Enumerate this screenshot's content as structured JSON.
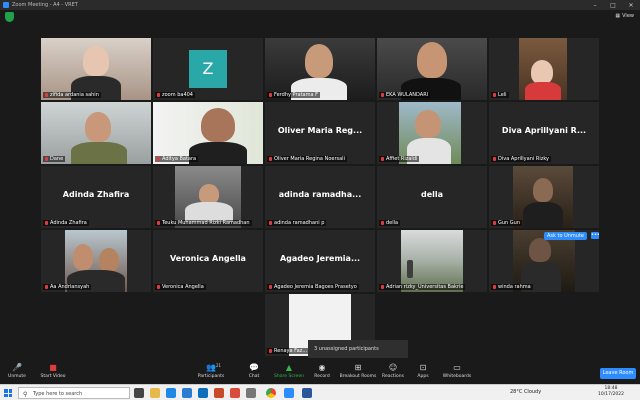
{
  "window": {
    "title": "Zoom Meeting - A4 - VRET",
    "controls": [
      "–",
      "□",
      "✕"
    ]
  },
  "topbar": {
    "view_label": "View"
  },
  "participants": [
    {
      "name": "zifida ardania sahin"
    },
    {
      "name": "zoom ba404",
      "avatar_letter": "Z"
    },
    {
      "name": "Ferdhy Pratama F"
    },
    {
      "name": "EKA WULANDARI"
    },
    {
      "name": "Leli"
    },
    {
      "name": "Dane"
    },
    {
      "name": "Aditya Batara"
    },
    {
      "name": "Oliver Maria Regina Noersali",
      "display": "Oliver Maria Reg..."
    },
    {
      "name": "Affiet Rizaldi"
    },
    {
      "name": "Diva Aprillyani Rizky",
      "display": "Diva Aprillyani R..."
    },
    {
      "name": "Adinda Zhafira",
      "display": "Adinda Zhafira"
    },
    {
      "name": "Teuku Muhammad Rizki Ramadhan"
    },
    {
      "name": "adinda ramadhani p",
      "display": "adinda ramadha..."
    },
    {
      "name": "della",
      "display": "della"
    },
    {
      "name": "Gun Gun"
    },
    {
      "name": "Aa Andriansyah"
    },
    {
      "name": "Veronica Angella",
      "display": "Veronica Angella"
    },
    {
      "name": "Agadeo Jeremia Bagoes Prasetyo",
      "display": "Agadeo Jeremia..."
    },
    {
      "name": "Adrian rizky_Universitas Bakrie"
    },
    {
      "name": "winda rahma"
    },
    {
      "name": "Renaya Faz..."
    }
  ],
  "ask_to_unmute": "Ask to Unmute",
  "more_dots": "•••",
  "unassigned": "3 unassigned participants",
  "toolbar": {
    "unmute": "Unmute",
    "start_video": "Start Video",
    "participants": "Participants",
    "participants_count": "21",
    "chat": "Chat",
    "share_screen": "Share Screen",
    "record": "Record",
    "breakout_rooms": "Breakout Rooms",
    "reactions": "Reactions",
    "apps": "Apps",
    "whiteboards": "Whiteboards",
    "leave": "Leave Room"
  },
  "taskbar": {
    "search_placeholder": "Type here to search",
    "weather": "28°C  Cloudy",
    "time": "18:48",
    "date": "10/17/2022"
  },
  "colors": {
    "accent": "#2d8cff",
    "active_speaker": "#8fd14f",
    "green": "#39b54a"
  }
}
